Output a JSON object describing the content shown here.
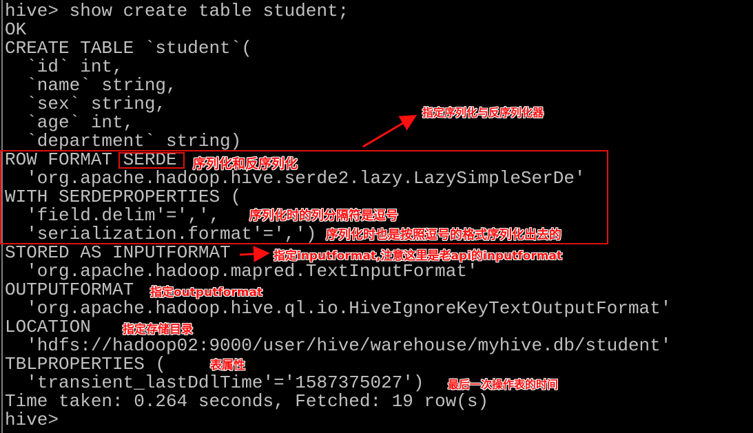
{
  "terminal": {
    "lines": [
      "hive> show create table student;",
      "OK",
      "CREATE TABLE `student`(",
      "  `id` int,",
      "  `name` string,",
      "  `sex` string,",
      "  `age` int,",
      "  `department` string)",
      "ROW FORMAT SERDE",
      "  'org.apache.hadoop.hive.serde2.lazy.LazySimpleSerDe'",
      "WITH SERDEPROPERTIES (",
      "  'field.delim'=',',",
      "  'serialization.format'=',')",
      "STORED AS INPUTFORMAT",
      "  'org.apache.hadoop.mapred.TextInputFormat'",
      "OUTPUTFORMAT",
      "  'org.apache.hadoop.hive.ql.io.HiveIgnoreKeyTextOutputFormat'",
      "LOCATION",
      "  'hdfs://hadoop02:9000/user/hive/warehouse/myhive.db/student'",
      "TBLPROPERTIES (",
      "  'transient_lastDdlTime'='1587375027')",
      "Time taken: 0.264 seconds, Fetched: 19 row(s)",
      "hive> "
    ]
  },
  "annotations": {
    "serde_class": "指定序列化与反序列化器",
    "serde": "序列化和反序列化",
    "field_delim": "序列化时的列分隔符是逗号",
    "serialization_format": "序列化时也是按照逗号的格式序列化出去的",
    "inputformat": "指定inputformat,注意这里是老api的inputformat",
    "outputformat": "指定outputformat",
    "location": "指定存储目录",
    "tblproperties": "表属性",
    "ddl_time": "最后一次操作表的时间"
  },
  "colors": {
    "text": "#c0c0c0",
    "annotation": "#ff1010",
    "background": "#000000"
  }
}
